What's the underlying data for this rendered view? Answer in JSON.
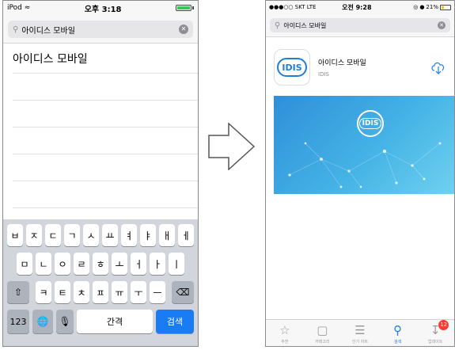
{
  "left_phone": {
    "status": {
      "carrier": "iPod",
      "time": "오후 3:18"
    },
    "search": {
      "query": "아이디스 모바일"
    },
    "suggestions": [
      "아이디스 모바일",
      "",
      "",
      "",
      "",
      "",
      ""
    ],
    "keyboard": {
      "row1": [
        "ㅂ",
        "ㅈ",
        "ㄷ",
        "ㄱ",
        "ㅅ",
        "ㅛ",
        "ㅕ",
        "ㅑ",
        "ㅐ",
        "ㅔ"
      ],
      "row2": [
        "ㅁ",
        "ㄴ",
        "ㅇ",
        "ㄹ",
        "ㅎ",
        "ㅗ",
        "ㅓ",
        "ㅏ",
        "ㅣ"
      ],
      "row3": [
        "ㅋ",
        "ㅌ",
        "ㅊ",
        "ㅍ",
        "ㅠ",
        "ㅜ",
        "ㅡ"
      ],
      "key_123": "123",
      "space_label": "간격",
      "search_label": "검색"
    }
  },
  "right_phone": {
    "status": {
      "carrier": "SKT",
      "network": "LTE",
      "time": "오전 9:28",
      "battery": "21%"
    },
    "search": {
      "query": "아이디스 모바일"
    },
    "app": {
      "icon_text": "IDIS",
      "name": "아이디스 모바일",
      "developer": "IDIS"
    },
    "banner": {
      "logo_text": "IDIS"
    },
    "tabs": [
      {
        "label": "추천",
        "icon": "star-icon",
        "active": false
      },
      {
        "label": "카테고리",
        "icon": "category-icon",
        "active": false
      },
      {
        "label": "인기 차트",
        "icon": "chart-list-icon",
        "active": false
      },
      {
        "label": "검색",
        "icon": "search-icon",
        "active": true
      },
      {
        "label": "업데이트",
        "icon": "update-icon",
        "active": false,
        "badge": "12"
      }
    ]
  },
  "colors": {
    "accent": "#1a7cf5",
    "badge": "#ff3b30",
    "banner": "#3aa3df"
  }
}
